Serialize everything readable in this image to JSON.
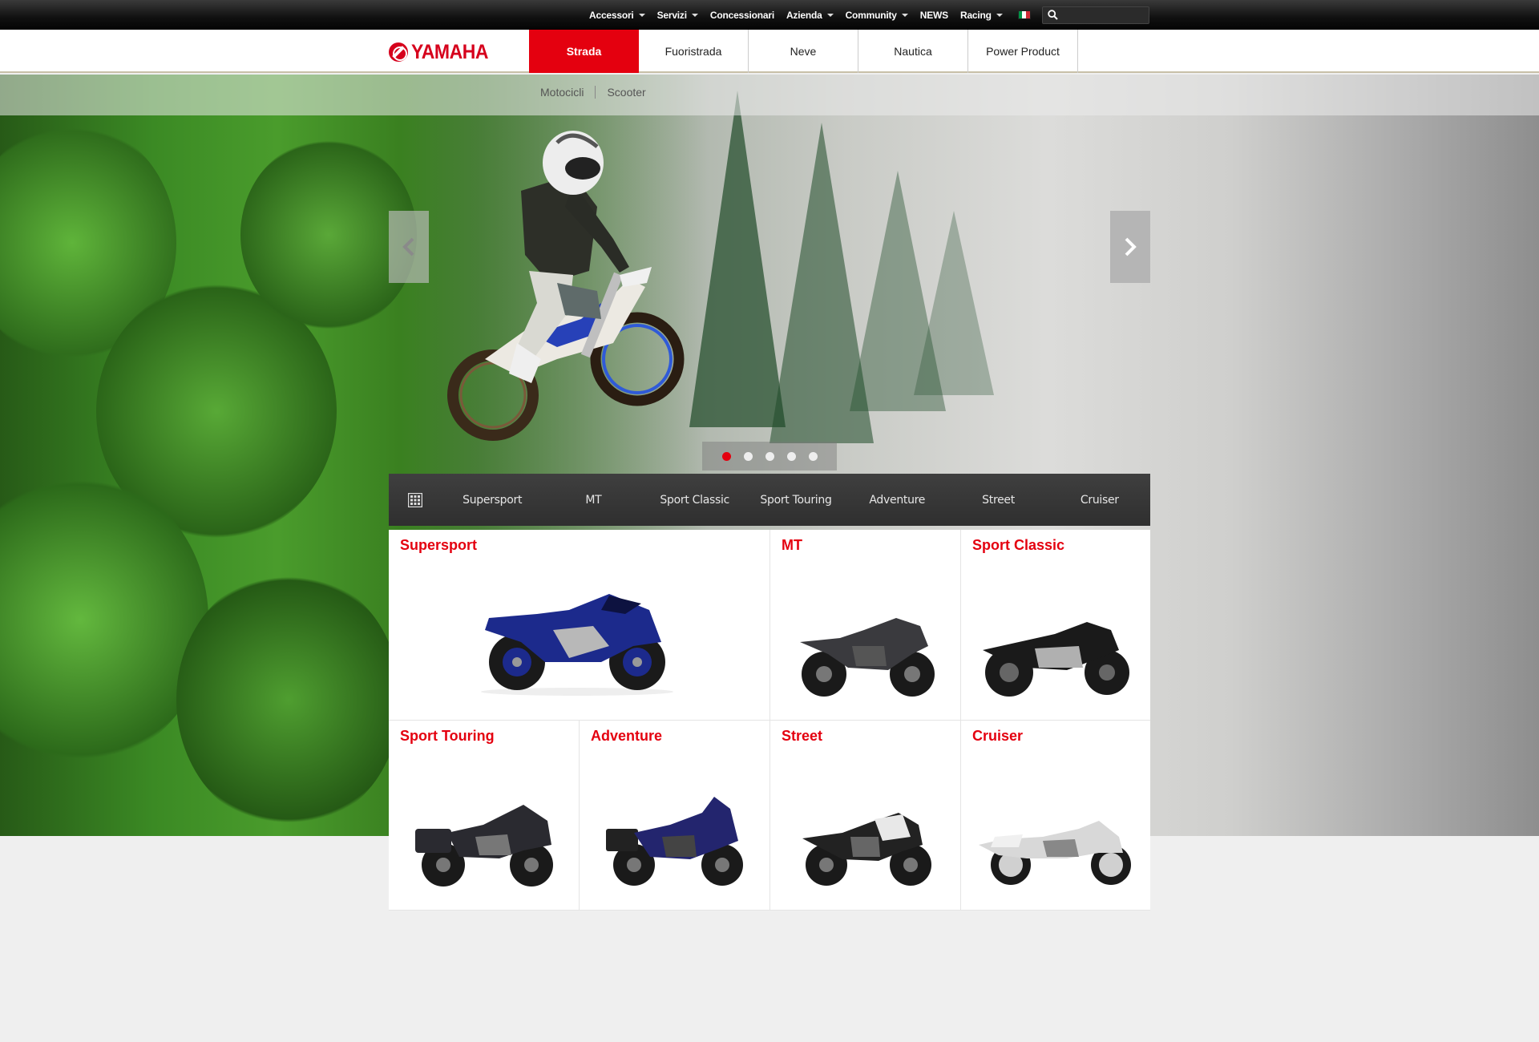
{
  "topbar": {
    "items": [
      {
        "label": "Accessori",
        "dropdown": true
      },
      {
        "label": "Servizi",
        "dropdown": true
      },
      {
        "label": "Concessionari",
        "dropdown": false
      },
      {
        "label": "Azienda",
        "dropdown": true
      },
      {
        "label": "Community",
        "dropdown": true
      },
      {
        "label": "NEWS",
        "dropdown": false
      },
      {
        "label": "Racing",
        "dropdown": true
      }
    ],
    "language_flag": "italy-flag-icon",
    "search": {
      "placeholder": "",
      "value": "",
      "icon": "search-icon"
    }
  },
  "brand": {
    "name": "YAMAHA",
    "color": "#d6001c"
  },
  "nav": {
    "tabs": [
      "Strada",
      "Fuoristrada",
      "Neve",
      "Nautica",
      "Power Product"
    ],
    "active": "Strada",
    "accent": "#e4000f"
  },
  "subnav": {
    "links": [
      "Motocicli",
      "Scooter"
    ]
  },
  "hero": {
    "slides_count": 5,
    "active_slide": 1,
    "prev_icon": "chevron-left-icon",
    "next_icon": "chevron-right-icon"
  },
  "categories": {
    "grid_icon": "grid-icon",
    "links": [
      "Supersport",
      "MT",
      "Sport Classic",
      "Sport Touring",
      "Adventure",
      "Street",
      "Cruiser"
    ]
  },
  "products": [
    {
      "title": "Supersport",
      "color": "#1c2a8c"
    },
    {
      "title": "MT",
      "color": "#3a3a3e"
    },
    {
      "title": "Sport Classic",
      "color": "#1a1a1a"
    },
    {
      "title": "Sport Touring",
      "color": "#2a2a30"
    },
    {
      "title": "Adventure",
      "color": "#23256e"
    },
    {
      "title": "Street",
      "color": "#222"
    },
    {
      "title": "Cruiser",
      "color": "#d8d8d8"
    }
  ]
}
